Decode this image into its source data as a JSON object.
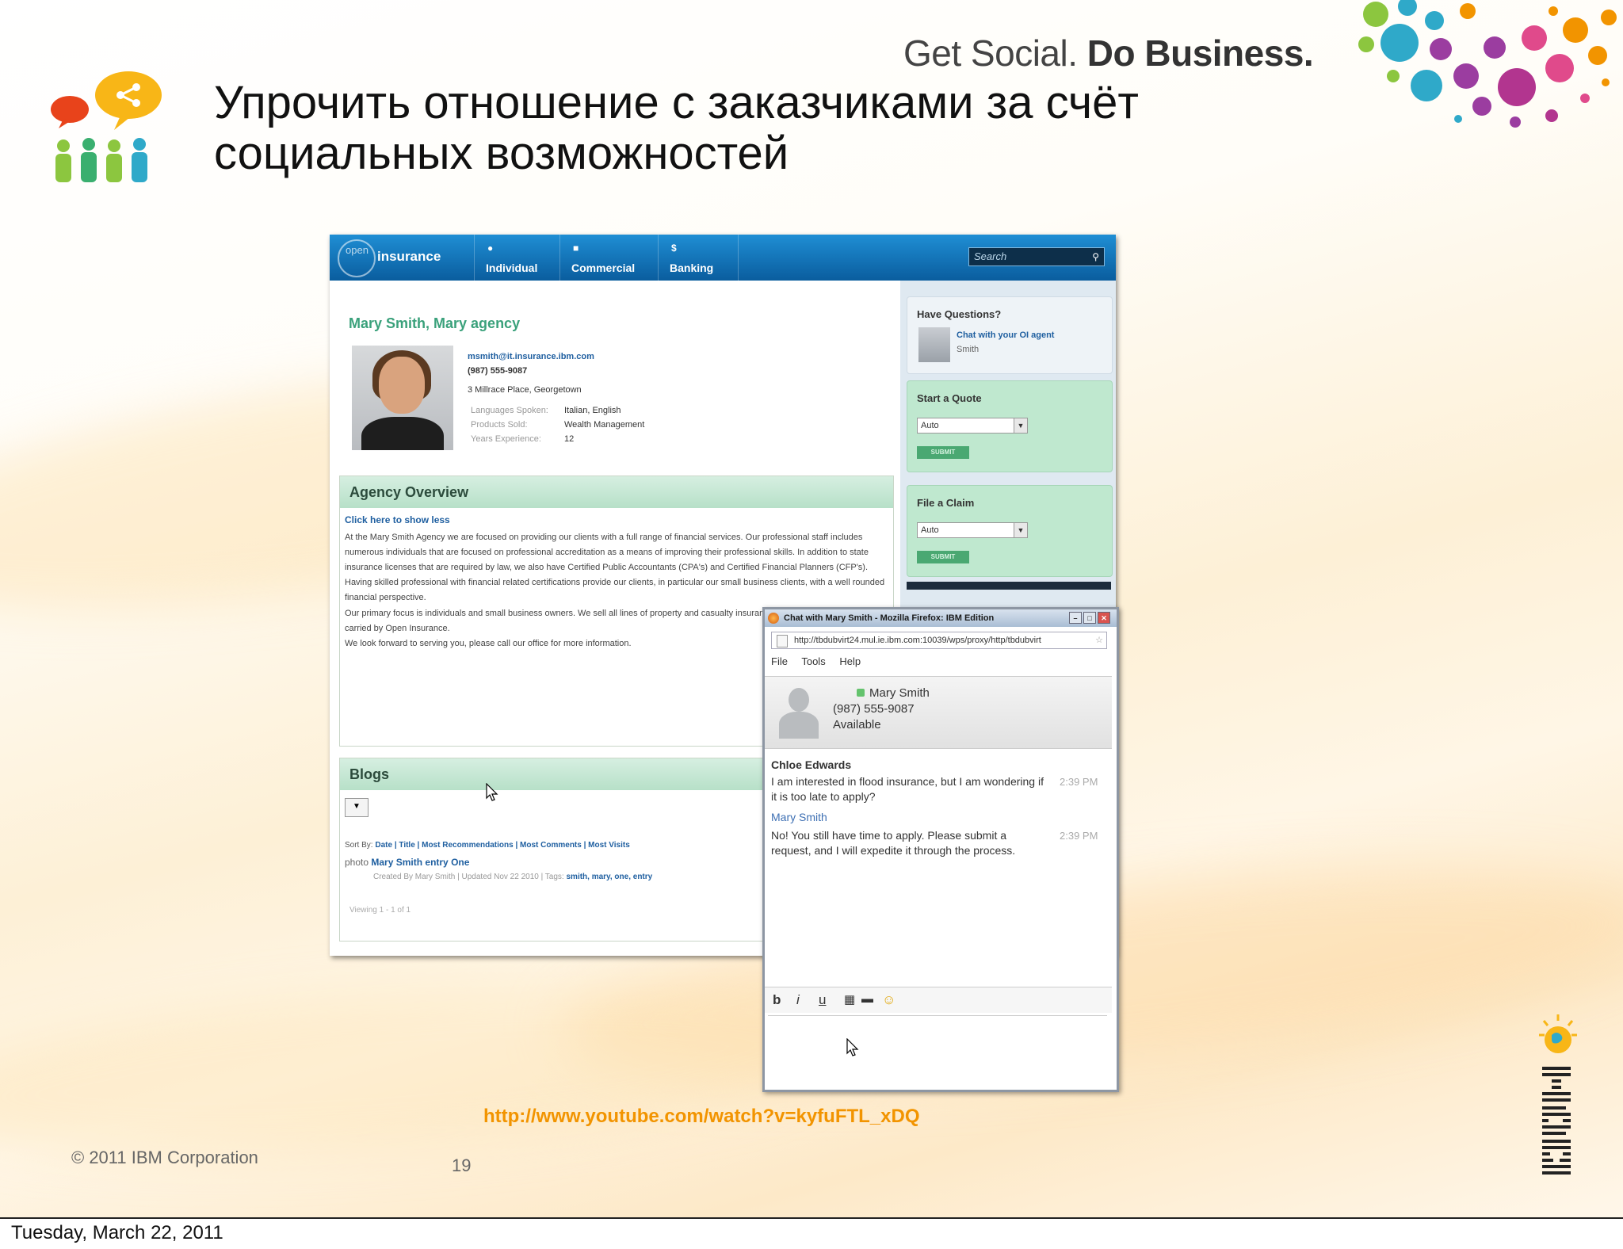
{
  "slide": {
    "tagline_light": "Get Social.",
    "tagline_bold": "Do Business.",
    "title_line1": "Упрочить отношение с заказчиками за счёт",
    "title_line2": "социальных возможностей",
    "video_url": "http://www.youtube.com/watch?v=kyfuFTL_xDQ",
    "copyright": "© 2011  IBM Corporation",
    "page_number": "19",
    "date": "Tuesday, March 22, 2011"
  },
  "portal": {
    "brand_light": "open",
    "brand": "insurance",
    "tabs": [
      {
        "label": "Individual",
        "icon": "person-icon"
      },
      {
        "label": "Commercial",
        "icon": "building-icon"
      },
      {
        "label": "Banking",
        "icon": "dollar-icon"
      }
    ],
    "search_placeholder": "Search",
    "agent_name": "Mary Smith,  Mary agency",
    "email": "msmith@it.insurance.ibm.com",
    "phone": "(987) 555-9087",
    "address": "3 Millrace Place, Georgetown",
    "meta": [
      {
        "label": "Languages Spoken:",
        "value": "Italian, English"
      },
      {
        "label": "Products Sold:",
        "value": "Wealth Management"
      },
      {
        "label": "Years Experience:",
        "value": "12"
      }
    ],
    "overview": {
      "title": "Agency Overview",
      "toggle": "Click here to show less",
      "p1": "At the Mary Smith Agency we are focused on providing our clients with a full range of financial services.  Our professional staff includes numerous individuals that are focused on professional accreditation as a means of improving their professional skills.  In addition to state insurance licenses that are required by law, we also have Certified Public Accountants (CPA's) and Certified Financial Planners (CFP's).  Having skilled professional with financial related certifications provide our clients, in particular our small business clients, with a well rounded financial perspective.",
      "p2": "Our primary focus is individuals and small business owners.  We sell all lines of property and casualty insurance and all financial products carried by Open Insurance.",
      "p3": "We look forward to serving you, please call our office for more  information."
    },
    "blogs": {
      "title": "Blogs",
      "sort_label": "Sort By:",
      "sort_options": "Date | Title | Most Recommendations | Most Comments | Most Visits",
      "entry_prefix": "photo",
      "entry_title": "Mary Smith entry One",
      "entry_meta": "Created By Mary Smith  |  Updated Nov 22 2010  |  Tags:",
      "entry_tags": "smith, mary, one, entry",
      "viewing": "Viewing 1 - 1 of 1"
    },
    "sidebar": {
      "questions_title": "Have Questions?",
      "chat_link": "Chat with your OI agent",
      "chat_agent": "Smith",
      "quote_title": "Start a Quote",
      "quote_value": "Auto",
      "submit": "SUBMIT",
      "claim_title": "File a Claim",
      "claim_value": "Auto"
    }
  },
  "chat": {
    "window_title": "Chat with Mary Smith - Mozilla Firefox: IBM Edition",
    "url": "http://tbdubvirt24.mul.ie.ibm.com:10039/wps/proxy/http/tbdubvirt",
    "menu": [
      "File",
      "Tools",
      "Help"
    ],
    "contact_name": "Mary Smith",
    "contact_phone": "(987) 555-9087",
    "contact_status": "Available",
    "messages": [
      {
        "from": "Chloe Edwards",
        "text": "I am interested in flood insurance, but I am wondering if it is too late to apply?",
        "time": "2:39 PM"
      },
      {
        "from": "Mary Smith",
        "text": "No! You still have time to apply.  Please submit a request, and I will expedite it through the process.",
        "time": "2:39 PM"
      }
    ],
    "format_buttons": [
      "b",
      "i",
      "u"
    ]
  },
  "colors": {
    "accent_orange": "#f29400",
    "portal_blue": "#0a5d9e",
    "panel_green": "#b7e0c8",
    "agent_green": "#3aa17b"
  }
}
